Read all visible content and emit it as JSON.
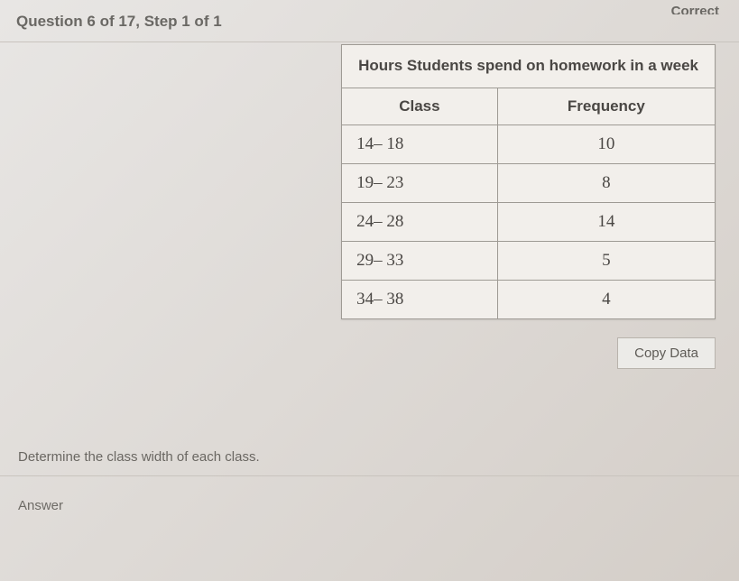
{
  "header": {
    "question_label": "Question 6 of 17, Step 1 of 1",
    "correct_partial": "Correct"
  },
  "table": {
    "title": "Hours Students spend on homework in a week",
    "col1": "Class",
    "col2": "Frequency",
    "rows": [
      {
        "class": "14– 18",
        "freq": "10"
      },
      {
        "class": "19– 23",
        "freq": "8"
      },
      {
        "class": "24– 28",
        "freq": "14"
      },
      {
        "class": "29– 33",
        "freq": "5"
      },
      {
        "class": "34– 38",
        "freq": "4"
      }
    ]
  },
  "buttons": {
    "copy_data": "Copy Data"
  },
  "prompt": "Determine the class width of each class.",
  "answer_label": "Answer",
  "chart_data": {
    "type": "table",
    "title": "Hours Students spend on homework in a week",
    "columns": [
      "Class",
      "Frequency"
    ],
    "rows": [
      [
        "14–18",
        10
      ],
      [
        "19–23",
        8
      ],
      [
        "24–28",
        14
      ],
      [
        "29–33",
        5
      ],
      [
        "34–38",
        4
      ]
    ]
  }
}
